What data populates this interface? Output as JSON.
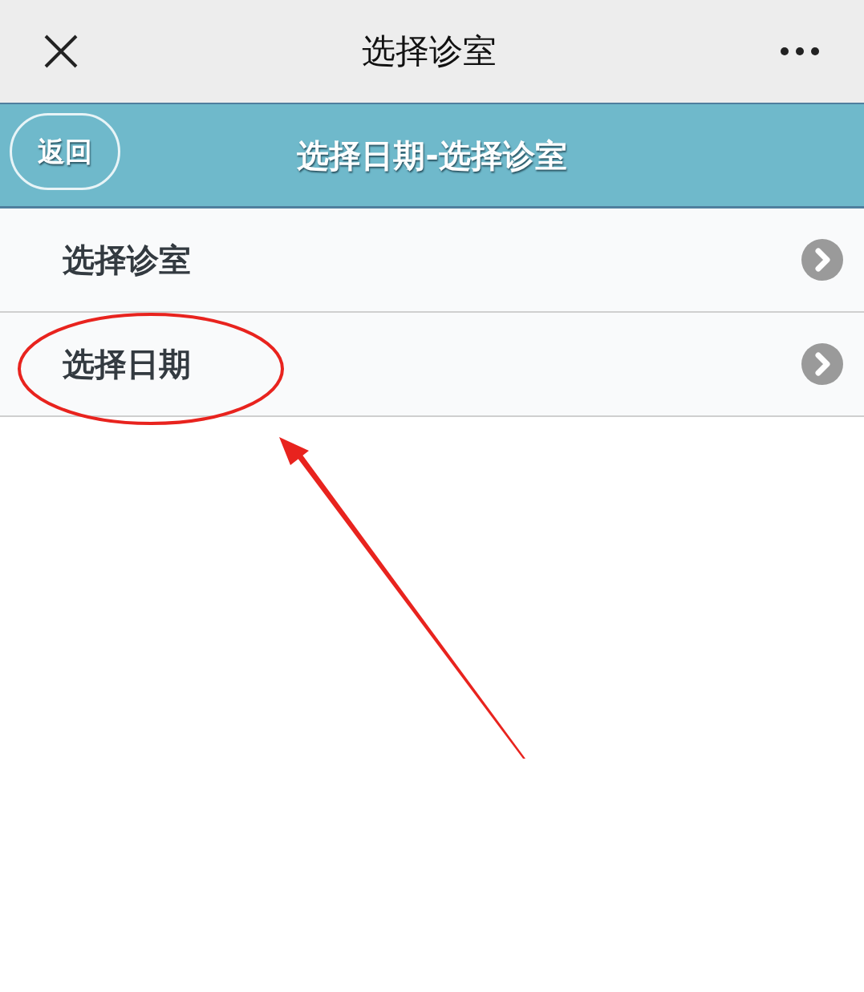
{
  "nav_bar": {
    "title": "选择诊室"
  },
  "header": {
    "back_button": "返回",
    "title": "选择日期-选择诊室"
  },
  "menu_items": [
    {
      "label": "选择诊室"
    },
    {
      "label": "选择日期"
    }
  ]
}
